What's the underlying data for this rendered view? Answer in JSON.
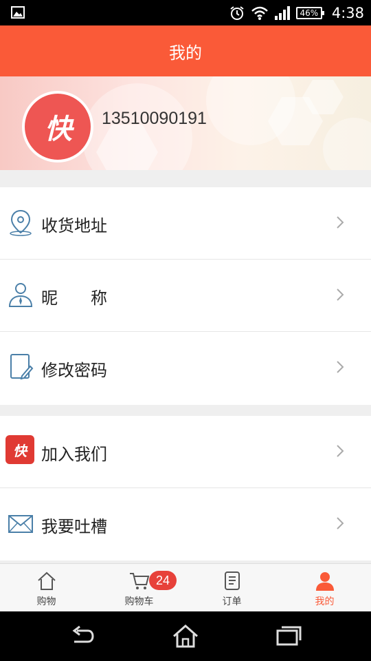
{
  "status_bar": {
    "time": "4:38",
    "battery": "46%",
    "icons": [
      "image-icon",
      "alarm-icon",
      "wifi-icon",
      "signal-icon",
      "battery-icon"
    ]
  },
  "header": {
    "title": "我的"
  },
  "profile": {
    "phone": "13510090191",
    "avatar_text": "快"
  },
  "menu_group_1": [
    {
      "label": "收货地址",
      "icon": "location-pin-icon"
    },
    {
      "label": "昵　　称",
      "icon": "user-icon"
    },
    {
      "label": "修改密码",
      "icon": "edit-icon"
    }
  ],
  "menu_group_2": [
    {
      "label": "加入我们",
      "icon": "brand-logo-icon"
    },
    {
      "label": "我要吐槽",
      "icon": "mail-icon"
    }
  ],
  "tab_bar": {
    "tabs": [
      {
        "label": "购物",
        "icon": "home-icon"
      },
      {
        "label": "购物车",
        "icon": "cart-icon",
        "badge": "24"
      },
      {
        "label": "订单",
        "icon": "order-icon"
      },
      {
        "label": "我的",
        "icon": "person-icon",
        "active": true
      }
    ]
  },
  "colors": {
    "accent": "#fa5a38",
    "badge": "#e7413a",
    "icon_blue": "#4a7fa8"
  }
}
